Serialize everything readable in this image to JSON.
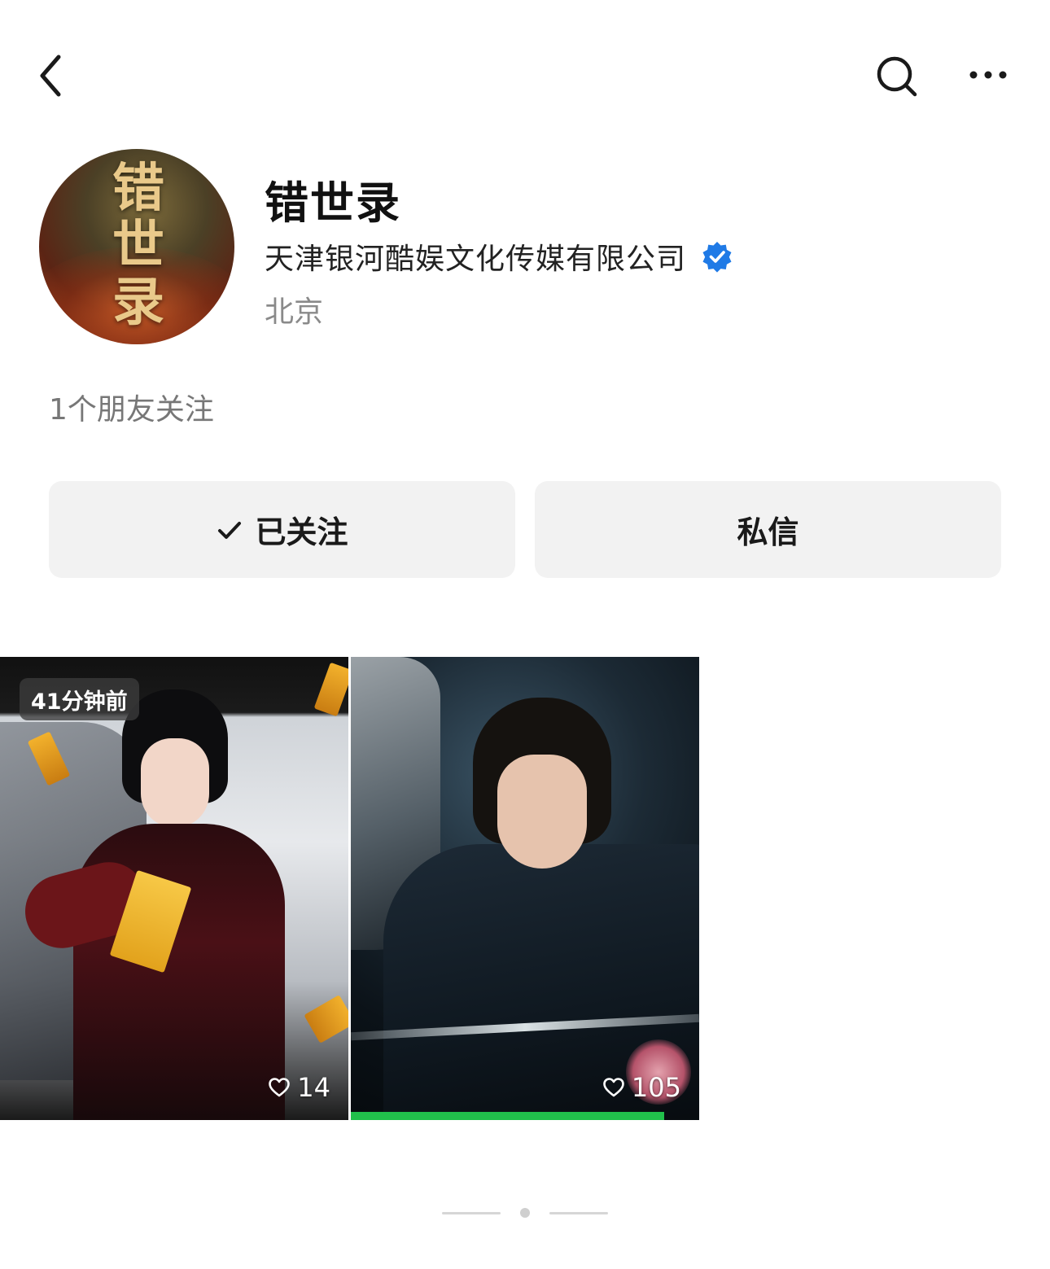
{
  "topbar": {
    "back_icon": "chevron-left-icon",
    "search_icon": "search-icon",
    "more_icon": "ellipsis-icon"
  },
  "profile": {
    "avatar_text": "错世录",
    "name": "错世录",
    "company": "天津银河酷娱文化传媒有限公司",
    "verified_icon": "verified-badge-icon",
    "verified_color": "#1f7ae6",
    "location": "北京",
    "friends_following": "1个朋友关注"
  },
  "actions": {
    "follow_label": "已关注",
    "message_label": "私信"
  },
  "videos": [
    {
      "time_badge": "41分钟前",
      "likes": "14"
    },
    {
      "likes": "105",
      "progress": 0.9,
      "progress_color": "#21c04b"
    }
  ],
  "pager": {
    "count": 3,
    "active_index": 1
  }
}
